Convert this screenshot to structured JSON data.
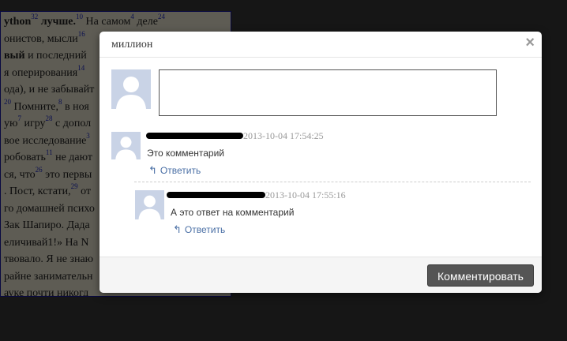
{
  "background_doc": {
    "lines": [
      {
        "parts": [
          {
            "t": "ython",
            "b": true
          },
          {
            "s": "32"
          },
          {
            "t": " лучше.",
            "b": true
          },
          {
            "s": "10"
          },
          {
            "t": " На самом"
          },
          {
            "s": "4"
          },
          {
            "t": " деле"
          },
          {
            "s": "24"
          }
        ]
      },
      {
        "parts": [
          {
            "t": "онистов, мысли"
          },
          {
            "s": "16"
          }
        ]
      },
      {
        "parts": [
          {
            "t": "вый",
            "b": true
          },
          {
            "t": " и последний"
          }
        ]
      },
      {
        "parts": [
          {
            "t": "я оперирования"
          },
          {
            "s": "14"
          }
        ]
      },
      {
        "parts": [
          {
            "t": "ода), и не забывайт"
          }
        ]
      },
      {
        "parts": [
          {
            "s": "20"
          },
          {
            "t": " Помните,"
          },
          {
            "s": "8"
          },
          {
            "t": " в ноя"
          }
        ]
      },
      {
        "parts": [
          {
            "t": "ую"
          },
          {
            "s": "7"
          },
          {
            "t": " игру"
          },
          {
            "s": "28"
          },
          {
            "t": " с допол"
          }
        ]
      },
      {
        "parts": [
          {
            "t": "вое исследование"
          },
          {
            "s": "3"
          }
        ]
      },
      {
        "parts": [
          {
            "t": "робовать"
          },
          {
            "s": "11"
          },
          {
            "t": " не дают"
          }
        ]
      },
      {
        "parts": [
          {
            "t": "ся, что"
          },
          {
            "s": "26"
          },
          {
            "t": " это первы"
          }
        ]
      },
      {
        "parts": [
          {
            "t": ". Пост, кстати,"
          },
          {
            "s": "29"
          },
          {
            "t": " от"
          }
        ]
      },
      {
        "parts": [
          {
            "t": "го домашней психо"
          }
        ]
      },
      {
        "parts": [
          {
            "t": "Зак Шапиро. Дада"
          }
        ]
      },
      {
        "parts": [
          {
            "t": "еличивай1!» На N"
          }
        ]
      },
      {
        "parts": [
          {
            "t": "твовало. Я не знаю"
          }
        ]
      },
      {
        "parts": [
          {
            "t": "райне занимательн"
          }
        ]
      },
      {
        "parts": [
          {
            "t": "ауке почти никогд"
          }
        ]
      }
    ]
  },
  "modal": {
    "title": "миллион",
    "close_label": "×",
    "comment_input_value": "",
    "comments": [
      {
        "author_redacted": true,
        "timestamp": "2013-10-04 17:54:25",
        "text": "Это комментарий",
        "reply_label": "Ответить"
      },
      {
        "author_redacted": true,
        "timestamp": "2013-10-04 17:55:16",
        "text": "А это ответ на комментарий",
        "reply_label": "Ответить"
      }
    ],
    "submit_label": "Комментировать"
  },
  "icons": {
    "reply": "reply-arrow-icon",
    "avatar": "user-silhouette-icon",
    "close": "close-icon"
  },
  "colors": {
    "link": "#4a6fa5",
    "avatar_bg": "#c9d3e6",
    "button_bg": "#555555"
  }
}
